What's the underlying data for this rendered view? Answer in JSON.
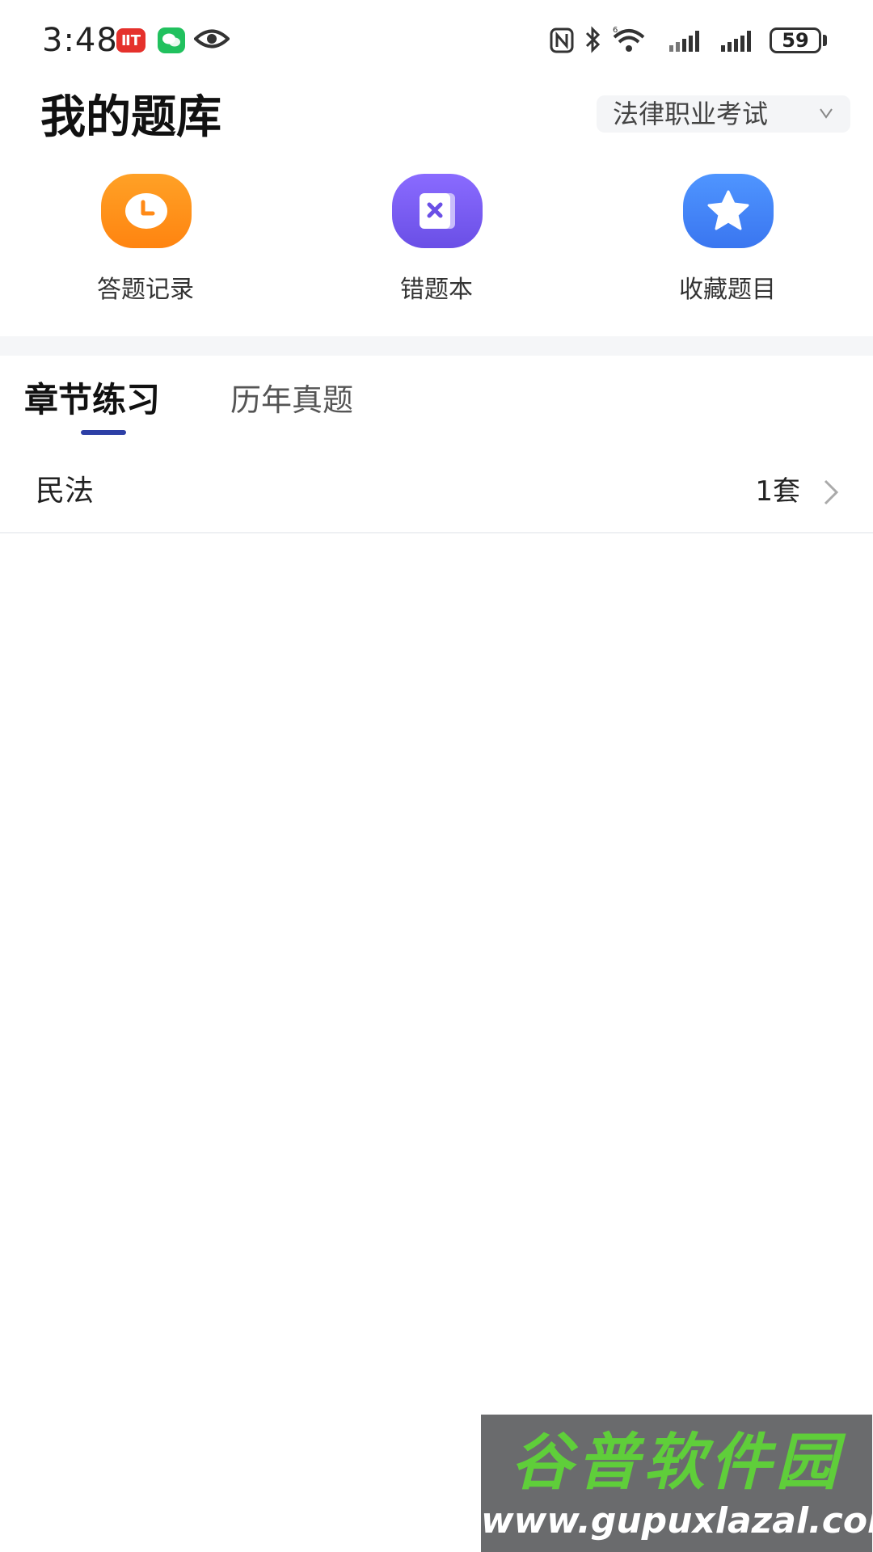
{
  "status_bar": {
    "time": "3:48",
    "battery": "59",
    "red_badge_text": "ⅡT"
  },
  "header": {
    "title": "我的题库",
    "exam_selector": "法律职业考试"
  },
  "quick_actions": [
    {
      "label": "答题记录",
      "icon": "clock-icon",
      "color": "#ff8a17"
    },
    {
      "label": "错题本",
      "icon": "wrong-book-icon",
      "color": "#7a5cf0"
    },
    {
      "label": "收藏题目",
      "icon": "star-icon",
      "color": "#3e87ff"
    }
  ],
  "tabs": [
    {
      "label": "章节练习",
      "active": true
    },
    {
      "label": "历年真题",
      "active": false
    }
  ],
  "list": [
    {
      "title": "民法",
      "count": "1套"
    }
  ],
  "watermark": {
    "cn": "谷普软件园",
    "url": "www.gupuxlazal.com"
  },
  "colors": {
    "tab_indicator": "#2d3fa6",
    "divider": "#f5f6f8"
  }
}
